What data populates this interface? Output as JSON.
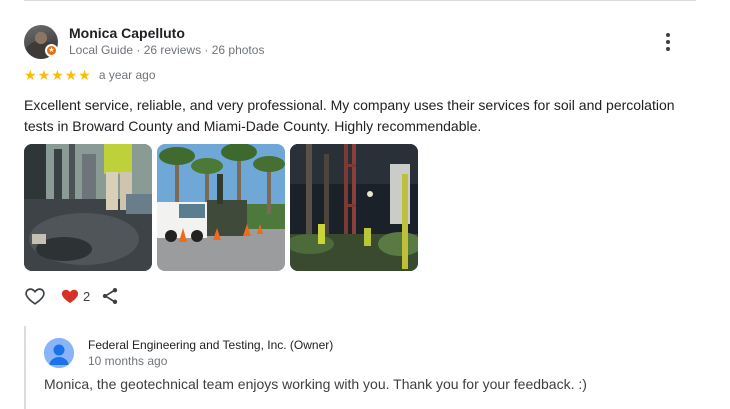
{
  "review": {
    "reviewer_name": "Monica Capelluto",
    "reviewer_meta": "Local Guide · 26 reviews · 26 photos",
    "rating": 5,
    "stars": [
      "★",
      "★",
      "★",
      "★",
      "★"
    ],
    "date": "a year ago",
    "text": "Excellent service, reliable, and very professional. My company uses their services for soil and percolation tests in Broward County and Miami-Dade County. Highly recommendable.",
    "photos": [
      "photo-drilling-closeup",
      "photo-drill-truck-palms",
      "photo-drill-rig-night"
    ]
  },
  "actions": {
    "like_icon": "heart-outline-icon",
    "liked_icon": "heart-filled-icon",
    "like_count": "2",
    "share_icon": "share-icon"
  },
  "owner_reply": {
    "owner_name": "Federal Engineering and Testing, Inc. (Owner)",
    "date": "10 months ago",
    "text": "Monica, the geotechnical team enjoys working with you. Thank you for your feedback. :)"
  },
  "colors": {
    "star": "#fbbc04",
    "heart_liked": "#d93025",
    "secondary_text": "#70757a",
    "guide_badge": "#e8710a",
    "owner_avatar": "#8ab4f8"
  }
}
